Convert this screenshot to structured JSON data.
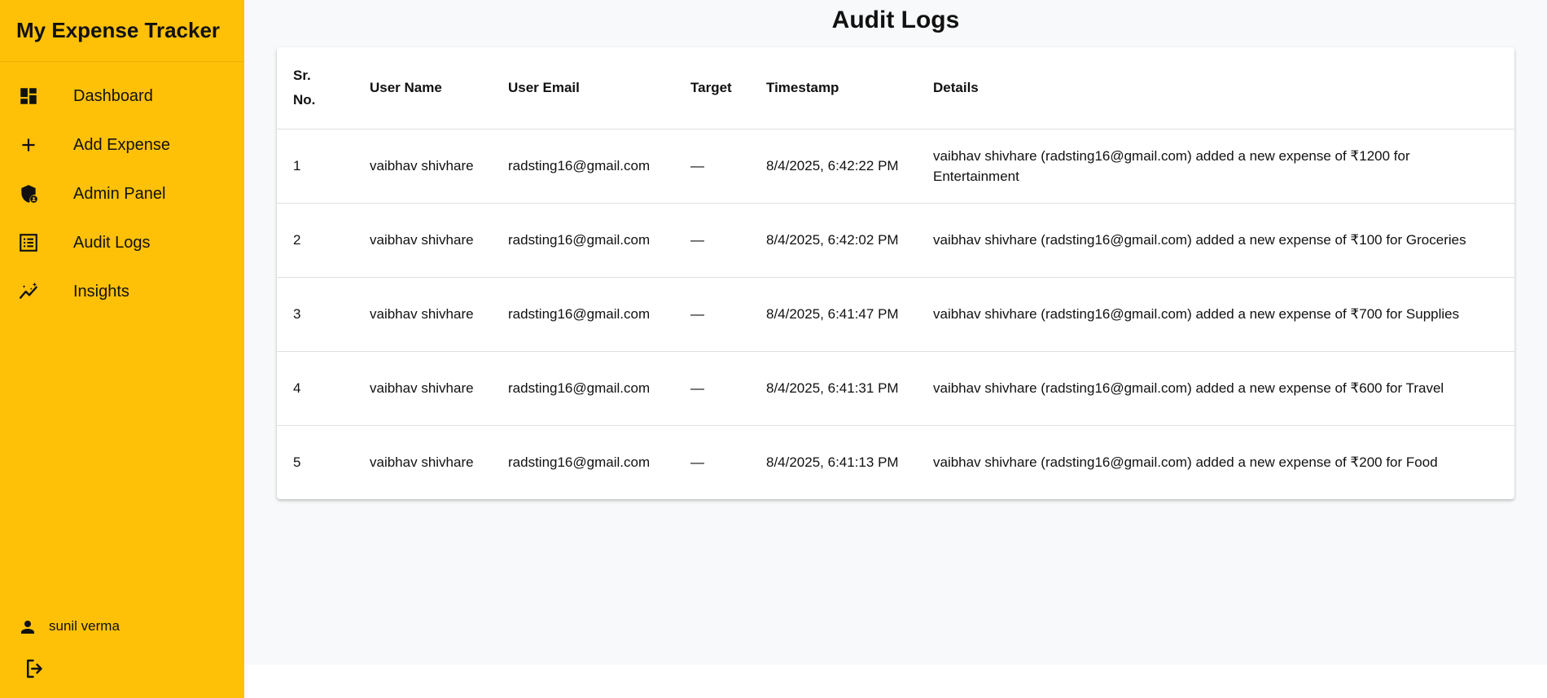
{
  "app": {
    "title": "My Expense Tracker"
  },
  "sidebar": {
    "items": [
      {
        "label": "Dashboard",
        "icon": "dashboard-icon"
      },
      {
        "label": "Add Expense",
        "icon": "plus-icon"
      },
      {
        "label": "Admin Panel",
        "icon": "admin-shield-icon"
      },
      {
        "label": "Audit Logs",
        "icon": "list-icon"
      },
      {
        "label": "Insights",
        "icon": "insights-icon"
      }
    ],
    "user": {
      "name": "sunil verma",
      "icon": "person-icon"
    },
    "logout_icon": "logout-icon"
  },
  "colors": {
    "sidebar_bg": "#ffc107",
    "main_bg": "#f8f9fa"
  },
  "main": {
    "title": "Audit Logs",
    "table": {
      "headers": [
        "Sr. No.",
        "User Name",
        "User Email",
        "Target",
        "Timestamp",
        "Details"
      ],
      "rows": [
        {
          "sr": "1",
          "user_name": "vaibhav shivhare",
          "email": "radsting16@gmail.com",
          "target": "—",
          "timestamp": "8/4/2025, 6:42:22 PM",
          "details": "vaibhav shivhare (radsting16@gmail.com) added a new expense of ₹1200 for Entertainment"
        },
        {
          "sr": "2",
          "user_name": "vaibhav shivhare",
          "email": "radsting16@gmail.com",
          "target": "—",
          "timestamp": "8/4/2025, 6:42:02 PM",
          "details": "vaibhav shivhare (radsting16@gmail.com) added a new expense of ₹100 for Groceries"
        },
        {
          "sr": "3",
          "user_name": "vaibhav shivhare",
          "email": "radsting16@gmail.com",
          "target": "—",
          "timestamp": "8/4/2025, 6:41:47 PM",
          "details": "vaibhav shivhare (radsting16@gmail.com) added a new expense of ₹700 for Supplies"
        },
        {
          "sr": "4",
          "user_name": "vaibhav shivhare",
          "email": "radsting16@gmail.com",
          "target": "—",
          "timestamp": "8/4/2025, 6:41:31 PM",
          "details": "vaibhav shivhare (radsting16@gmail.com) added a new expense of ₹600 for Travel"
        },
        {
          "sr": "5",
          "user_name": "vaibhav shivhare",
          "email": "radsting16@gmail.com",
          "target": "—",
          "timestamp": "8/4/2025, 6:41:13 PM",
          "details": "vaibhav shivhare (radsting16@gmail.com) added a new expense of ₹200 for Food"
        }
      ]
    }
  }
}
